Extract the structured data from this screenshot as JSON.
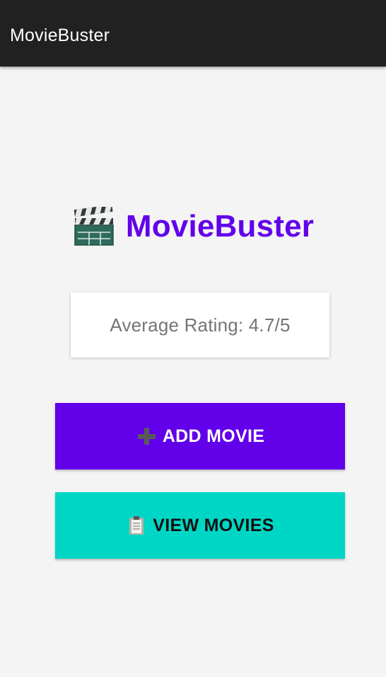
{
  "app_bar": {
    "title": "MovieBuster"
  },
  "hero": {
    "icon": "clapperboard-icon",
    "title": "MovieBuster"
  },
  "rating_card": {
    "text": "Average Rating: 4.7/5"
  },
  "buttons": {
    "add": {
      "icon": "plus-icon",
      "label": "ADD MOVIE"
    },
    "view": {
      "icon": "clipboard-icon",
      "label": "VIEW MOVIES"
    }
  },
  "colors": {
    "app_bar": "#212121",
    "brand": "#6200ea",
    "add_button": "#6200ea",
    "view_button": "#00d6c5",
    "background": "#f4f4f4"
  }
}
